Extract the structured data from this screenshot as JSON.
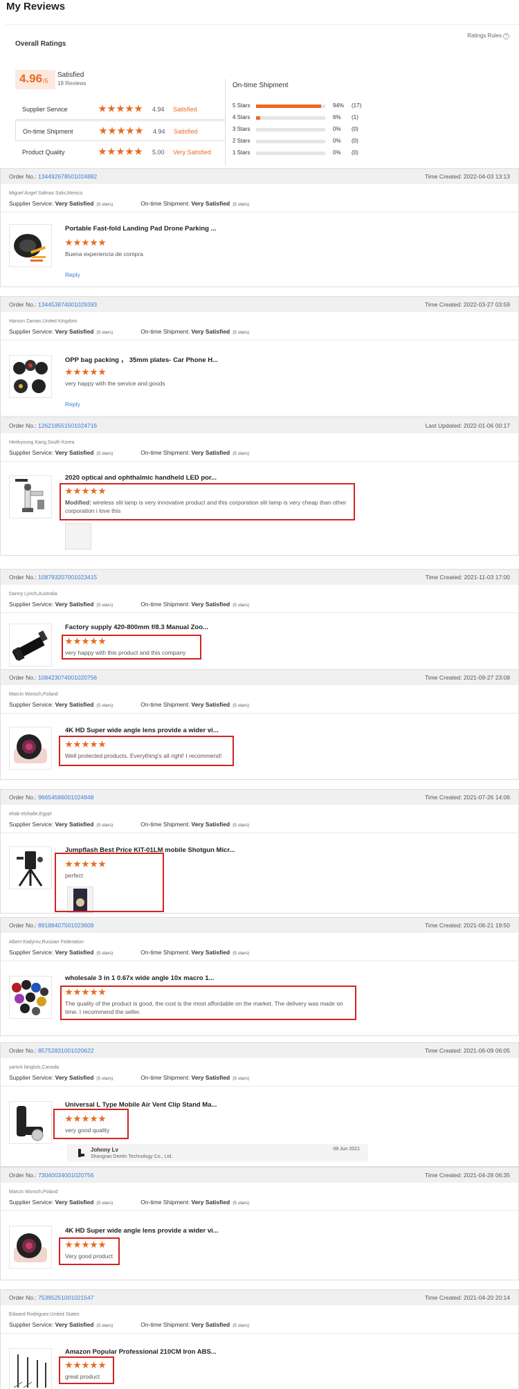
{
  "page": {
    "title": "My Reviews"
  },
  "summary": {
    "title": "Overall Ratings",
    "rules_label": "Ratings Rules",
    "score": "4.96",
    "score_of": "/5",
    "label": "Satisfied",
    "count": "18 Reviews",
    "rows": [
      {
        "label": "Supplier Service",
        "stars": 5,
        "score": "4.94",
        "status": "Satisfied"
      },
      {
        "label": "On-time Shipment",
        "stars": 5,
        "score": "4.94",
        "status": "Satisfied"
      },
      {
        "label": "Product Quality",
        "stars": 5,
        "score": "5.00",
        "status": "Very Satisfied"
      }
    ],
    "dist_title": "On-time Shipment",
    "distribution": [
      {
        "label": "5 Stars",
        "fraction": 0.94,
        "pct": "94%",
        "count": "(17)"
      },
      {
        "label": "4 Stars",
        "fraction": 0.06,
        "pct": "6%",
        "count": "(1)"
      },
      {
        "label": "3 Stars",
        "fraction": 0,
        "pct": "0%",
        "count": "(0)"
      },
      {
        "label": "2 Stars",
        "fraction": 0,
        "pct": "0%",
        "count": "(0)"
      },
      {
        "label": "1 Stars",
        "fraction": 0,
        "pct": "0%",
        "count": "(0)"
      }
    ],
    "accent_color": "#e86b23"
  },
  "labels": {
    "order_no": "Order No.:",
    "supplier_service": "Supplier Service:",
    "ontime_shipment": "On-time Shipment:",
    "very_satisfied": "Very Satisfied",
    "five_stars": "(5 stars)",
    "reply": "Reply",
    "modified": "Modified:"
  },
  "reviews": [
    {
      "order": "134492678501024882",
      "time_label": "Time Created:",
      "time": "2022-04-03 13:13",
      "buyer": "Miguel Angel Salinas Solis,Mexico",
      "product": "Portable Fast-fold Landing Pad Drone Parking ...",
      "text": "Buena experiencia de compra"
    },
    {
      "order": "134453874001029393",
      "time_label": "Time Created:",
      "time": "2022-03-27 03:59",
      "buyer": "Haroon Zaman,United Kingdom",
      "product": "OPP bag packing ， 35mm plates- Car Phone H...",
      "text": "very happy with the service and goods"
    },
    {
      "order": "126218551501024716",
      "time_label": "Last Updated:",
      "time": "2022-01-06 00:17",
      "buyer": "Heekyoung Kang,South Korea",
      "product": "2020 optical and ophthalmic handheld LED por...",
      "text": "wireless slit lamp is very innovative product and this corporation slit lamp is very cheap than other corporation i love this"
    },
    {
      "order": "108793207001023415",
      "time_label": "Time Created:",
      "time": "2021-11-03 17:00",
      "buyer": "Danny Lynch,Australia",
      "product": "Factory supply 420-800mm f/8.3 Manual Zoo...",
      "text": "very happy with this product and this company"
    },
    {
      "order": "108423074001020756",
      "time_label": "Time Created:",
      "time": "2021-09-27 23:08",
      "buyer": "Marcin Woroch,Poland",
      "product": "4K HD Super wide angle lens provide a wider vi...",
      "text": "Well protected products. Everything's all right! I recommend!"
    },
    {
      "order": "96654586001024848",
      "time_label": "Time Created:",
      "time": "2021-07-26 14:06",
      "buyer": "ehab elshafie,Egypt",
      "product": "Jumpflash Best Price KIT-01LM mobile Shotgun Micr...",
      "text": "perfect"
    },
    {
      "order": "89188407501023609",
      "time_label": "Time Created:",
      "time": "2021-06-21 19:50",
      "buyer": "Albert Kadyrov,Russian Federation",
      "product": "wholesale 3 in 1 0.67x wide angle 10x macro 1...",
      "text": "The quality of the product is good, the cost is the most affordable on the market.  The delivery was made on time.  I recommend the seller."
    },
    {
      "order": "85752831001020622",
      "time_label": "Time Created:",
      "time": "2021-06-09 06:05",
      "buyer": "yanick langlois,Canada",
      "product": "Universal L Type Mobile Air Vent Clip Stand Ma...",
      "text": "very good quality",
      "reply_name": "Johnny Lv",
      "reply_company": "Shangrao Deetin Technology Co., Ltd.",
      "reply_date": "09 Jun 2021"
    },
    {
      "order": "73040034001020756",
      "time_label": "Time Created:",
      "time": "2021-04-28 06:35",
      "buyer": "Marcin Woroch,Poland",
      "product": "4K HD Super wide angle lens provide a wider vi...",
      "text": "Very good product"
    },
    {
      "order": "75395251001021547",
      "time_label": "Time Created:",
      "time": "2021-04-20 20:14",
      "buyer": "Edward Rodriguez,United States",
      "product": "Amazon Popular Professional 210CM Iron ABS...",
      "text": "great product"
    }
  ]
}
